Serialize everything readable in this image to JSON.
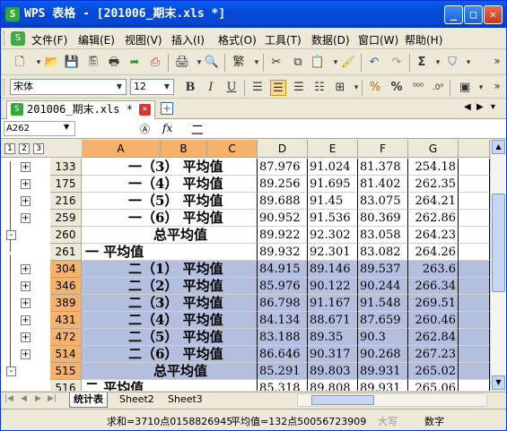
{
  "window": {
    "title": "WPS 表格 - [201006_期末.xls *]",
    "app_icon": "S",
    "btn_min": "_",
    "btn_max": "□",
    "btn_close": "✕"
  },
  "menu": [
    "文件(F)",
    "编辑(E)",
    "视图(V)",
    "插入(I)",
    "格式(O)",
    "工具(T)",
    "数据(D)",
    "窗口(W)",
    "帮助(H)"
  ],
  "toolbar2": {
    "font": "宋体",
    "size": "12",
    "bold": "B",
    "italic": "I",
    "underline": "U"
  },
  "doc_tab": {
    "label": "201006_期末.xls *"
  },
  "formula": {
    "name_box": "A262",
    "fx": "fx",
    "value": "二"
  },
  "outline_levels": [
    "1",
    "2",
    "3"
  ],
  "columns": [
    "A",
    "B",
    "C",
    "D",
    "E",
    "F",
    "G"
  ],
  "rows": [
    {
      "num": "133",
      "a": "一（3） 平均值",
      "d": "87.976",
      "e": "91.024",
      "f": "81.378",
      "g": "254.18",
      "sel": false,
      "exp": "+"
    },
    {
      "num": "175",
      "a": "一（4） 平均值",
      "d": "89.256",
      "e": "91.695",
      "f": "81.402",
      "g": "262.35",
      "sel": false,
      "exp": "+"
    },
    {
      "num": "216",
      "a": "一（5） 平均值",
      "d": "89.688",
      "e": "91.45",
      "f": "83.075",
      "g": "264.21",
      "sel": false,
      "exp": "+"
    },
    {
      "num": "259",
      "a": "一（6） 平均值",
      "d": "90.952",
      "e": "91.536",
      "f": "80.369",
      "g": "262.86",
      "sel": false,
      "exp": "+"
    },
    {
      "num": "260",
      "a": "总平均值",
      "d": "89.922",
      "e": "92.302",
      "f": "83.058",
      "g": "264.23",
      "sel": false,
      "exp": "-"
    },
    {
      "num": "261",
      "a": "一 平均值",
      "d": "89.932",
      "e": "92.301",
      "f": "83.082",
      "g": "264.26",
      "sel": false,
      "exp": ""
    },
    {
      "num": "304",
      "a": "二（1） 平均值",
      "d": "84.915",
      "e": "89.146",
      "f": "89.537",
      "g": "263.6",
      "sel": true,
      "exp": "+"
    },
    {
      "num": "346",
      "a": "二（2） 平均值",
      "d": "85.976",
      "e": "90.122",
      "f": "90.244",
      "g": "266.34",
      "sel": true,
      "exp": "+"
    },
    {
      "num": "389",
      "a": "二（3） 平均值",
      "d": "86.798",
      "e": "91.167",
      "f": "91.548",
      "g": "269.51",
      "sel": true,
      "exp": "+"
    },
    {
      "num": "431",
      "a": "二（4） 平均值",
      "d": "84.134",
      "e": "88.671",
      "f": "87.659",
      "g": "260.46",
      "sel": true,
      "exp": "+"
    },
    {
      "num": "472",
      "a": "二（5） 平均值",
      "d": "83.188",
      "e": "89.35",
      "f": "90.3",
      "g": "262.84",
      "sel": true,
      "exp": "+"
    },
    {
      "num": "514",
      "a": "二（6） 平均值",
      "d": "86.646",
      "e": "90.317",
      "f": "90.268",
      "g": "267.23",
      "sel": true,
      "exp": "+"
    },
    {
      "num": "515",
      "a": "总平均值",
      "d": "85.291",
      "e": "89.803",
      "f": "89.931",
      "g": "265.02",
      "sel": true,
      "exp": "-"
    },
    {
      "num": "516",
      "a": "二 平均值",
      "d": "85.318",
      "e": "89.808",
      "f": "89.931",
      "g": "265.06",
      "sel": false,
      "exp": ""
    }
  ],
  "sheets": [
    "统计表",
    "Sheet2",
    "Sheet3"
  ],
  "status": {
    "sum": "求和=3710点0158826945",
    "avg": "平均值=132点50056723909",
    "caps": "大写",
    "num": "数字"
  },
  "colors": {
    "selected_header": "#f5b26d",
    "selection": "#b4bfe0",
    "title_bar": "#0548d6"
  }
}
